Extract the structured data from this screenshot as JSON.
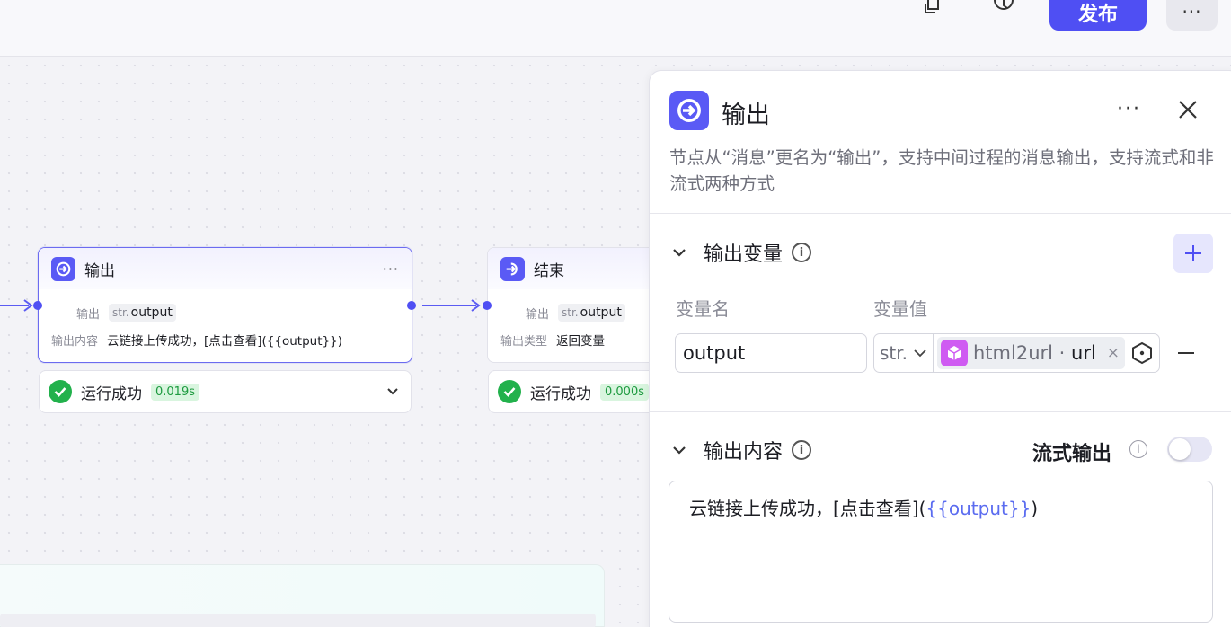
{
  "topbar": {
    "copy_icon": "copy-icon",
    "history_icon": "history-icon",
    "publish_label": "发布",
    "more_label": "···"
  },
  "canvas": {
    "output_node": {
      "title": "输出",
      "more": "···",
      "row1_label": "输出",
      "row1_type": "str.",
      "row1_value": "output",
      "row2_label": "输出内容",
      "row2_value": "云链接上传成功，[点击查看]({{output}})",
      "status_label": "运行成功",
      "status_time": "0.019s"
    },
    "end_node": {
      "title": "结束",
      "row1_label": "输出",
      "row1_type": "str.",
      "row1_value": "output",
      "row2_label": "输出类型",
      "row2_value": "返回变量",
      "status_label": "运行成功",
      "status_time": "0.000s"
    }
  },
  "panel": {
    "title": "输出",
    "more": "···",
    "description": "节点从“消息”更名为“输出”，支持中间过程的消息输出，支持流式和非流式两种方式",
    "output_vars": {
      "title": "输出变量",
      "info": "i",
      "col_name": "变量名",
      "col_value": "变量值",
      "var_name": "output",
      "var_type": "str.",
      "ref_source": "html2url",
      "ref_sep": " · ",
      "ref_field": "url",
      "ref_remove": "×"
    },
    "output_content": {
      "title": "输出内容",
      "info": "i",
      "stream_label": "流式输出",
      "stream_info": "i",
      "stream_enabled": false,
      "text_before": "云链接上传成功，[点击查看](",
      "text_var": "{{output}}",
      "text_after": ")"
    }
  },
  "colors": {
    "accent": "#4f4ff3",
    "success": "#22b14c",
    "plugin": "#cf5bf2"
  }
}
